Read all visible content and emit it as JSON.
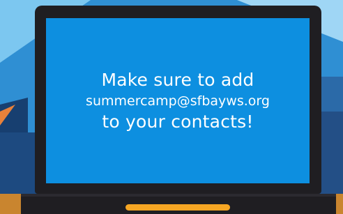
{
  "message": {
    "line1": "Make sure to add",
    "email": "summercamp@sfbayws.org",
    "line3": "to your contacts!"
  },
  "colors": {
    "screen": "#0d8fe0",
    "bezel": "#1f1e22",
    "accent": "#f6a623",
    "sky": "#1a4f87"
  }
}
